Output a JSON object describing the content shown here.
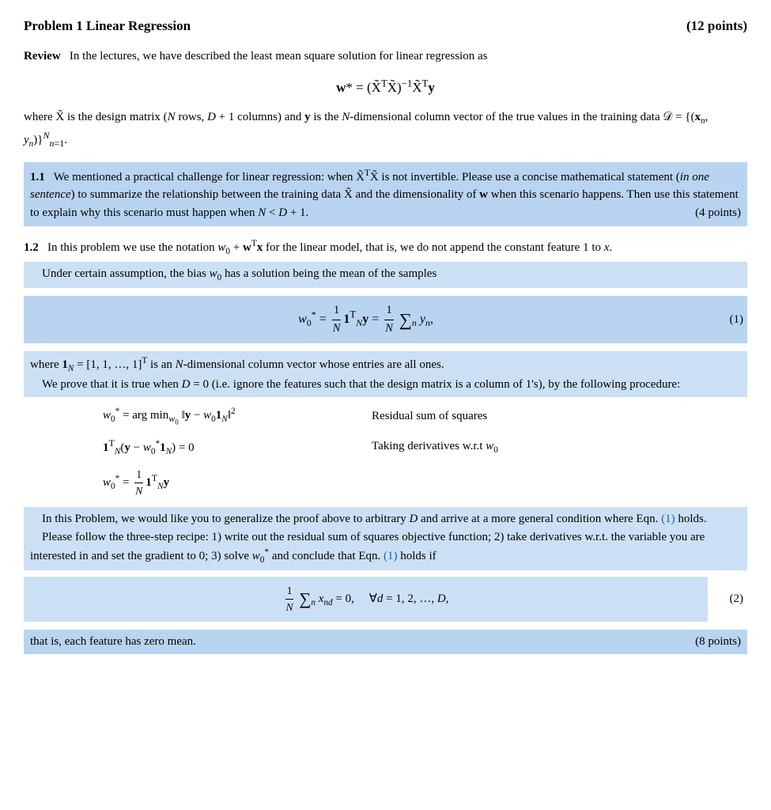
{
  "header": {
    "title": "Problem 1   Linear Regression",
    "points": "(12 points)"
  },
  "review": {
    "label": "Review",
    "text": "In the lectures, we have described the least mean square solution for linear regression as"
  },
  "formula_main": "w* = (X̃ᵀX̃)⁻¹X̃ᵀy",
  "where_text": "where X̃ is the design matrix (N rows, D + 1 columns) and y is the N-dimensional column vector of the true values in the training data 𝒟 = {(xₙ, yₙ)}ᴺₙ₌₁.",
  "section_1_1": {
    "number": "1.1",
    "text": "We mentioned a practical challenge for linear regression: when X̃ᵀX̃ is not invertible.  Please use a concise mathematical statement (in one sentence) to summarize the relationship between the training data X̃ and the dimensionality of w when this scenario happens.  Then use this statement to explain why this scenario must happen when N < D + 1.",
    "points": "(4 points)"
  },
  "section_1_2": {
    "number": "1.2",
    "text_before": "In this problem we use the notation w₀ + wᵀx for the linear model, that is, we do not append the constant feature 1 to x.",
    "under_text": "Under certain assumption, the bias w₀ has a solution being the mean of the samples",
    "equation_1_label": "(1)",
    "equation_1_text": "w₀* = (1/N) 1ᵀₙ y = (1/N) Σₙ yₙ,",
    "where_1N": "where 1ₙ = [1, 1, …, 1]ᵀ is an N-dimensional column vector whose entries are all ones.",
    "prove_text": "We prove that it is true when D = 0 (i.e.  ignore the features such that the design matrix is a column of 1's), by the following procedure:",
    "step1_formula": "w₀* = arg min ‖y − w₀1ₙ‖²",
    "step1_desc": "Residual sum of squares",
    "step2_formula": "1ᵀₙ(y − w₀*1ₙ) = 0",
    "step2_desc": "Taking derivatives w.r.t w₀",
    "step3_formula": "w₀* = (1/N) 1ᵀₙ y",
    "generalize_text1": "In this Problem, we would like you to generalize the proof above to arbitrary D and arrive at a more general condition where Eqn.",
    "generalize_link": "(1)",
    "generalize_text2": "holds.",
    "follow_text": "Please follow the three-step recipe: 1) write out the residual sum of squares objective function; 2) take derivatives w.r.t. the variable you are interested in and set the gradient to 0; 3) solve w₀* and conclude that Eqn.",
    "follow_link": "(1)",
    "follow_text2": "holds if",
    "equation_2_text": "(1/N) Σₙ xₙd = 0,   ∀d = 1, 2, …, D,",
    "equation_2_label": "(2)",
    "final_text": "that is, each feature has zero mean.",
    "final_points": "(8 points)"
  }
}
